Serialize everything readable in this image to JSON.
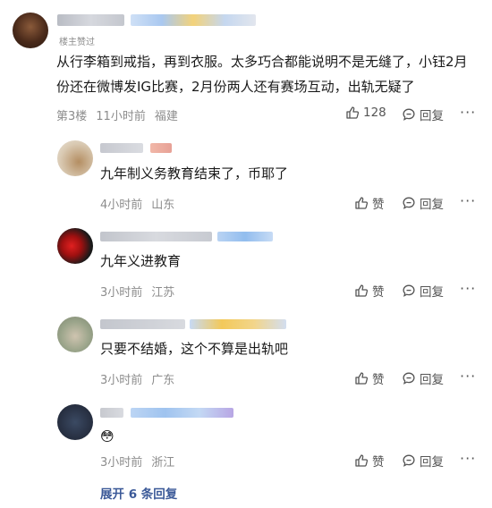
{
  "comment": {
    "author_badge": "楼主赞过",
    "text_line1": "从行李箱到戒指，再到衣服。太多巧合都能说明不是无缝了，小钰2月",
    "text_line2": "份还在微博发IG比赛，2月份两人还有赛场互动，出轨无疑了",
    "floor": "第3楼",
    "time": "11小时前",
    "location": "福建",
    "like_count": "128",
    "reply_label": "回复",
    "more": "···"
  },
  "replies": [
    {
      "text": "九年制义务教育结束了，币耶了",
      "time": "4小时前",
      "location": "山东",
      "like_label": "赞",
      "reply_label": "回复",
      "more": "···"
    },
    {
      "text": "九年义进教育",
      "time": "3小时前",
      "location": "江苏",
      "like_label": "赞",
      "reply_label": "回复",
      "more": "···"
    },
    {
      "text": "只要不结婚，这个不算是出轨吧",
      "time": "3小时前",
      "location": "广东",
      "like_label": "赞",
      "reply_label": "回复",
      "more": "···"
    },
    {
      "text": "😳",
      "time": "3小时前",
      "location": "浙江",
      "like_label": "赞",
      "reply_label": "回复",
      "more": "···"
    }
  ],
  "expand_label": "展开 6 条回复",
  "colors": {
    "link": "#3b5998",
    "meta": "#8c8c8c",
    "text": "#1a1a1a"
  }
}
